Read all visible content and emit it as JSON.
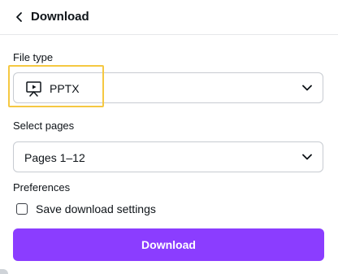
{
  "header": {
    "title": "Download",
    "back_icon": "chevron-left-icon"
  },
  "file_type": {
    "label": "File type",
    "selected": "PPTX",
    "icon": "presentation-icon",
    "dropdown_icon": "chevron-down-icon",
    "highlight_color": "#f5c842"
  },
  "select_pages": {
    "label": "Select pages",
    "selected": "Pages 1–12",
    "dropdown_icon": "chevron-down-icon"
  },
  "preferences": {
    "label": "Preferences",
    "checkbox_label": "Save download settings",
    "checked": false
  },
  "download_button": {
    "label": "Download",
    "color": "#8b3dff"
  }
}
